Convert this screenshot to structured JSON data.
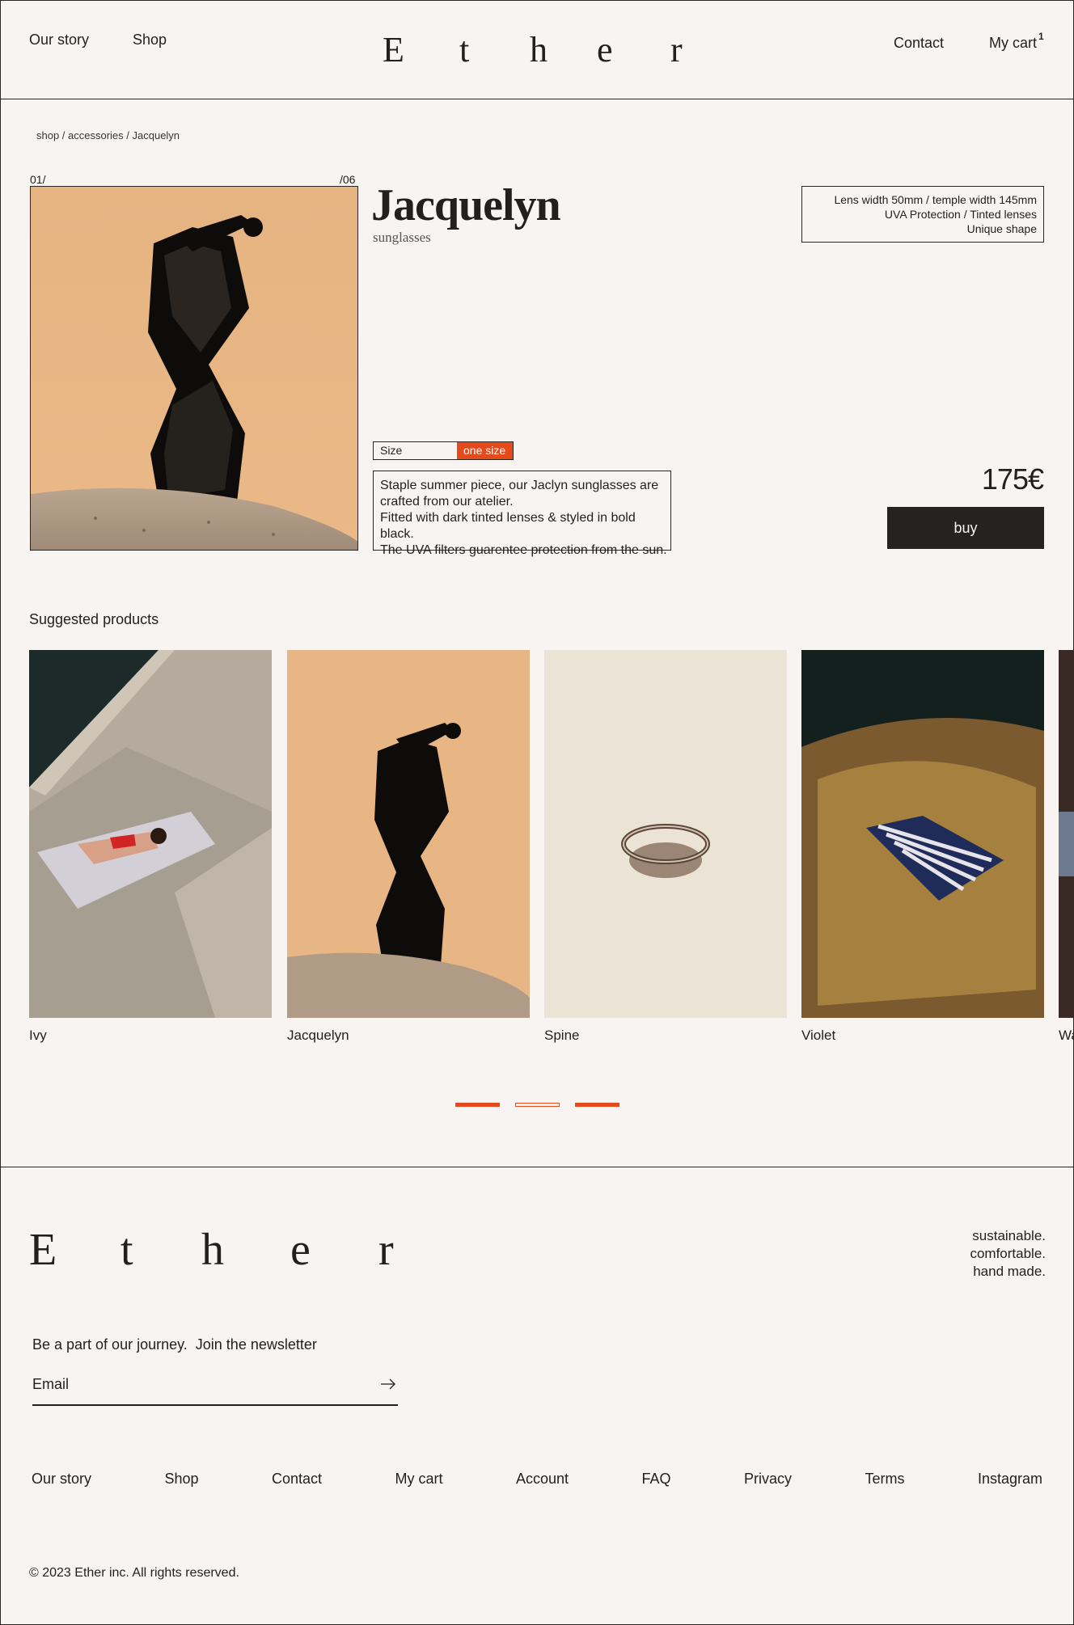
{
  "header": {
    "nav_left": [
      "Our story",
      "Shop"
    ],
    "logo_letters": [
      "E",
      "t",
      "h",
      "e",
      "r"
    ],
    "nav_right": [
      "Contact",
      "My cart"
    ],
    "cart_count": "1"
  },
  "breadcrumb": "shop / accessories / Jacquelyn",
  "gallery": {
    "current": "01/",
    "total": "/06"
  },
  "product": {
    "title": "Jacquelyn",
    "subtitle": "sunglasses",
    "specs": [
      "Lens width 50mm / temple width 145mm",
      "UVA Protection / Tinted lenses",
      "Unique shape"
    ],
    "size_label": "Size",
    "size_value": "one size",
    "description": [
      "Staple summer piece, our Jaclyn sunglasses are",
      "crafted from our atelier.",
      "Fitted with dark tinted lenses & styled in bold black.",
      "The UVA filters guarentee protection from the sun."
    ],
    "price": "175€",
    "buy_label": "buy"
  },
  "suggested": {
    "title": "Suggested products",
    "items": [
      {
        "name": "Ivy"
      },
      {
        "name": "Jacquelyn"
      },
      {
        "name": "Spine"
      },
      {
        "name": "Violet"
      },
      {
        "name": "Wa"
      }
    ]
  },
  "carousel": {
    "pages": 3,
    "active": [
      1,
      3
    ]
  },
  "footer": {
    "logo_letters": [
      "E",
      "t",
      "h",
      "e",
      "r"
    ],
    "tagline": [
      "sustainable.",
      "comfortable.",
      "hand made."
    ],
    "newsletter_title": "Be a part of our journey.  Join the newsletter",
    "email_placeholder": "Email",
    "links": [
      "Our story",
      "Shop",
      "Contact",
      "My cart",
      "Account",
      "FAQ",
      "Privacy",
      "Terms",
      "Instagram"
    ],
    "copyright": "© 2023 Ether inc. All rights reserved."
  },
  "colors": {
    "accent": "#e44a1c",
    "background": "#f8f4f1",
    "text": "#231f1e",
    "button": "#252221"
  }
}
